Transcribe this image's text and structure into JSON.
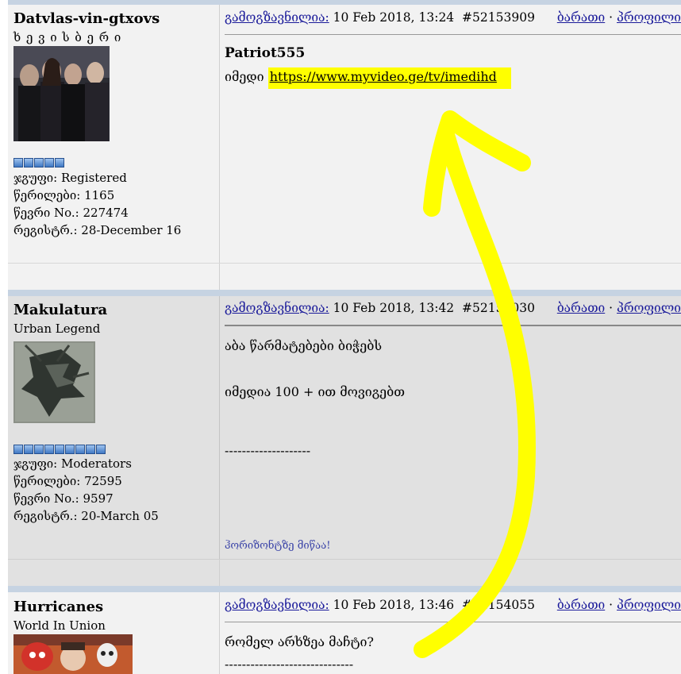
{
  "posts": [
    {
      "username": "Datvlas-vin-gtxovs",
      "user_title": "ხ ე ვ ი ს ბ ე რ ი",
      "pips": 5,
      "group_label": "ჯგუფი: Registered",
      "posts_label": "წერილები: 1165",
      "member_label": "წევრი No.: 227474",
      "registered_label": "რეგისტრ.: 28-December 16",
      "sent_label": "გამოგზავნილია:",
      "date": "10 Feb 2018, 13:24",
      "post_id": "#52153909",
      "card_link": "ბარათი",
      "dot": "·",
      "profile_link": "პროფილი",
      "more": "·",
      "quote_author": "Patriot555",
      "line1_prefix": "იმედი ",
      "line1_link": "https://www.myvideo.ge/tv/imedihd"
    },
    {
      "username": "Makulatura",
      "user_title": "Urban Legend",
      "pips": 9,
      "group_label": "ჯგუფი: Moderators",
      "posts_label": "წერილები: 72595",
      "member_label": "წევრი No.: 9597",
      "registered_label": "რეგისტრ.: 20-March 05",
      "sent_label": "გამოგზავნილია:",
      "date": "10 Feb 2018, 13:42",
      "post_id": "#52154030",
      "card_link": "ბარათი",
      "dot": "·",
      "profile_link": "პროფილი",
      "more": "·",
      "line1": "აბა წარმატებები ბიჭებს",
      "line2": "იმედია 100 + ით მოვიგებთ",
      "divider": "--------------------",
      "signature": "ჰორიზონტზე მიწაა!"
    },
    {
      "username": "Hurricanes",
      "user_title": "World In Union",
      "sent_label": "გამოგზავნილია:",
      "date": "10 Feb 2018, 13:46",
      "post_id": "#52154055",
      "card_link": "ბარათი",
      "dot": "·",
      "profile_link": "პროფილი",
      "more": "·",
      "line1": "რომელ არხზეა მაჩტი?",
      "divider": "------------------------------"
    }
  ],
  "colors": {
    "post_bg_1": "#f2f2f2",
    "post_bg_2": "#e1e1e1",
    "separator": "#c6d3e2",
    "link": "#1a1a9a",
    "highlight": "#ffff00"
  }
}
